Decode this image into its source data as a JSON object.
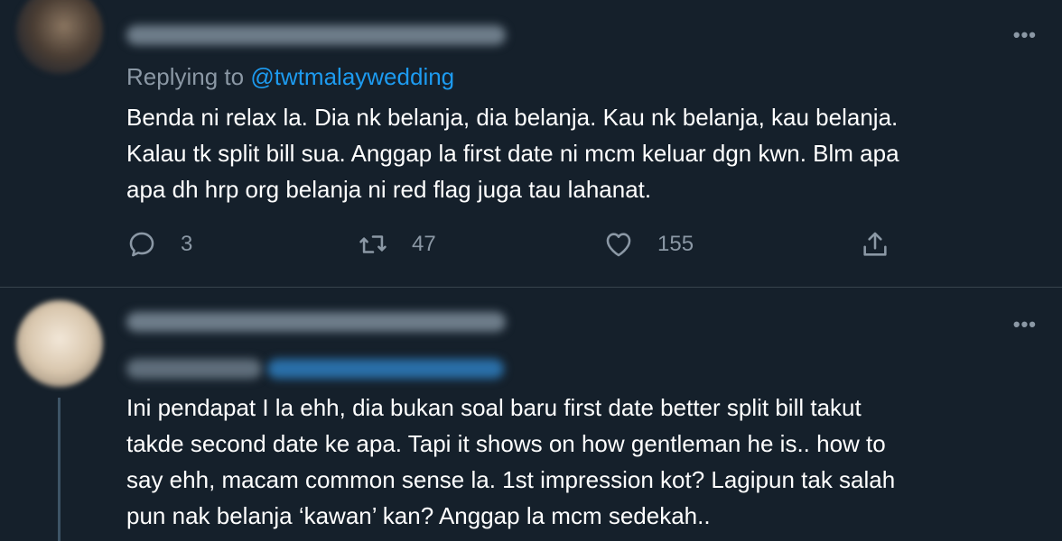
{
  "tweets": [
    {
      "replying_prefix": "Replying to ",
      "replying_handle": "@twtmalaywedding",
      "text_lines": [
        "Benda ni relax la. Dia nk belanja, dia belanja. Kau nk belanja, kau belanja.",
        "Kalau tk split bill sua. Anggap la first date ni mcm keluar dgn kwn. Blm apa",
        "apa dh hrp org belanja ni red flag juga tau lahanat."
      ],
      "reply_count": "3",
      "retweet_count": "47",
      "like_count": "155",
      "more_label": "•••"
    },
    {
      "text_lines": [
        "Ini pendapat I la ehh, dia bukan soal baru first date better split bill takut",
        "takde second date ke apa. Tapi it shows on how gentleman he is.. how to",
        "say ehh, macam common sense la. 1st impression kot? Lagipun tak salah",
        "pun nak belanja ‘kawan’ kan? Anggap la mcm sedekah.."
      ],
      "more_label": "•••"
    }
  ],
  "icons": {
    "reply": "reply-icon",
    "retweet": "retweet-icon",
    "like": "heart-icon",
    "share": "share-icon",
    "more": "more-icon"
  },
  "colors": {
    "background": "#15202b",
    "text": "#ffffff",
    "secondary": "#8b98a5",
    "accent": "#1d9bf0",
    "divider": "#38444d"
  }
}
